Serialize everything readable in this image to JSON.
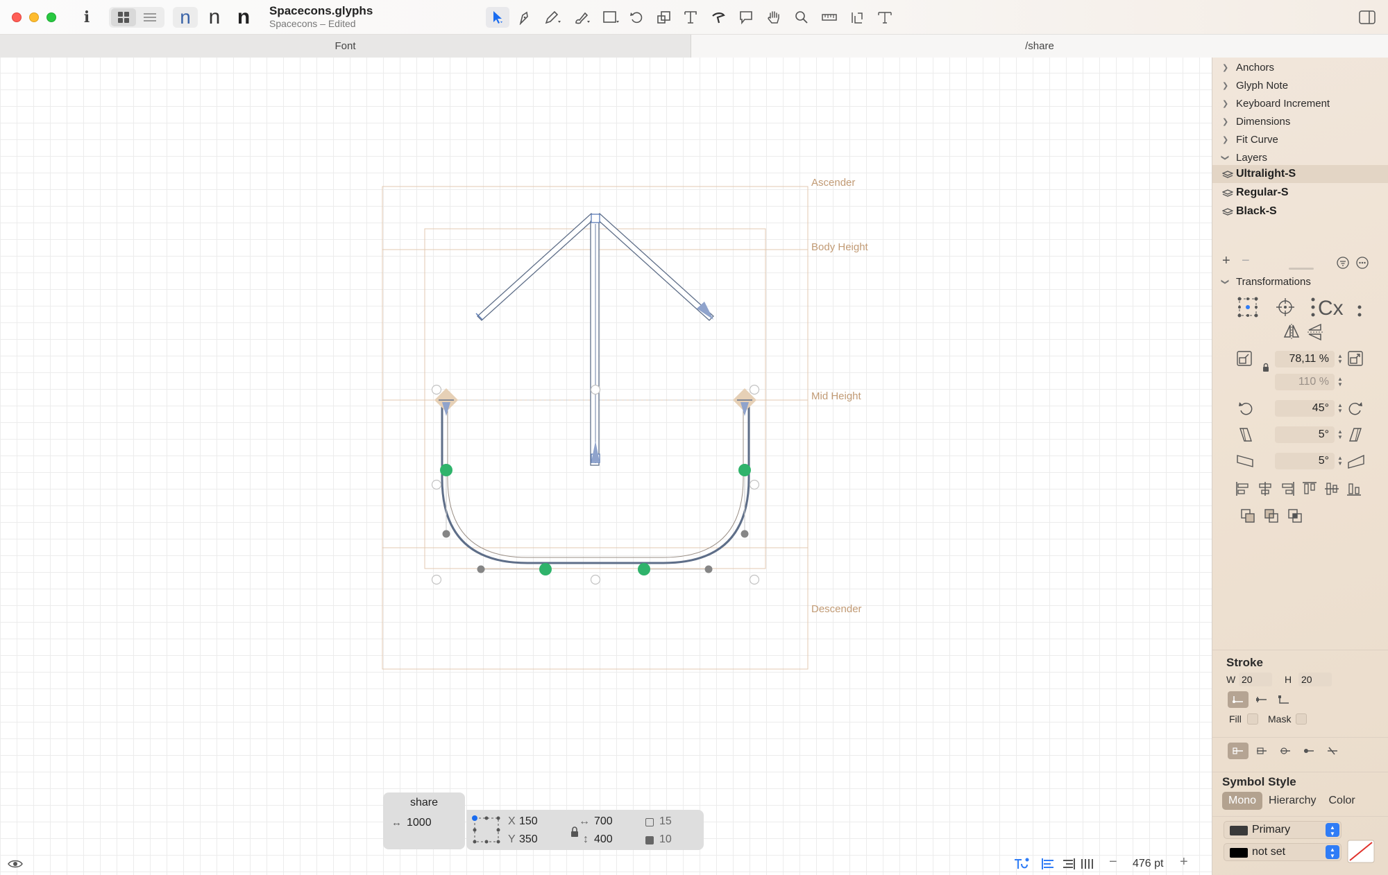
{
  "window": {
    "title": "Spacecons.glyphs",
    "subtitle": "Spacecons – Edited"
  },
  "toolbar": {
    "info_label": "i",
    "weight_glyphs": [
      "n",
      "n",
      "n"
    ]
  },
  "tabs": [
    {
      "label": "Font"
    },
    {
      "label": "/share"
    }
  ],
  "canvas": {
    "metrics": [
      {
        "name": "Ascender"
      },
      {
        "name": "Body Height"
      },
      {
        "name": "Mid Height"
      },
      {
        "name": "Descender"
      }
    ],
    "glyph_name": "share",
    "glyph_width": "1000",
    "selection": {
      "x_label": "X",
      "x": "150",
      "y_label": "Y",
      "y": "350",
      "width": "700",
      "height": "400",
      "count_a": "15",
      "count_b": "10"
    }
  },
  "statusbar": {
    "zoom": "476 pt"
  },
  "sidebar": {
    "sections": [
      "Anchors",
      "Glyph Note",
      "Keyboard Increment",
      "Dimensions",
      "Fit Curve",
      "Layers"
    ],
    "layers": [
      {
        "name": "Ultralight-S",
        "selected": true
      },
      {
        "name": "Regular-S",
        "selected": false
      },
      {
        "name": "Black-S",
        "selected": false
      }
    ],
    "transformations": {
      "title": "Transformations",
      "scale": "78,11 %",
      "scale_v": "110 %",
      "rotate": "45°",
      "slant": "5°",
      "skew": "5°"
    },
    "stroke": {
      "title": "Stroke",
      "w_label": "W",
      "w": "20",
      "h_label": "H",
      "h": "20",
      "fill_label": "Fill",
      "mask_label": "Mask"
    },
    "symbol_style": {
      "title": "Symbol Style",
      "modes": [
        "Mono",
        "Hierarchy",
        "Color"
      ],
      "active_mode": "Mono",
      "primary": "Primary",
      "secondary": "not set"
    }
  },
  "colors": {
    "accent": "#2f7cf6",
    "node_green": "#2fb36b",
    "metric": "#c19a74"
  }
}
